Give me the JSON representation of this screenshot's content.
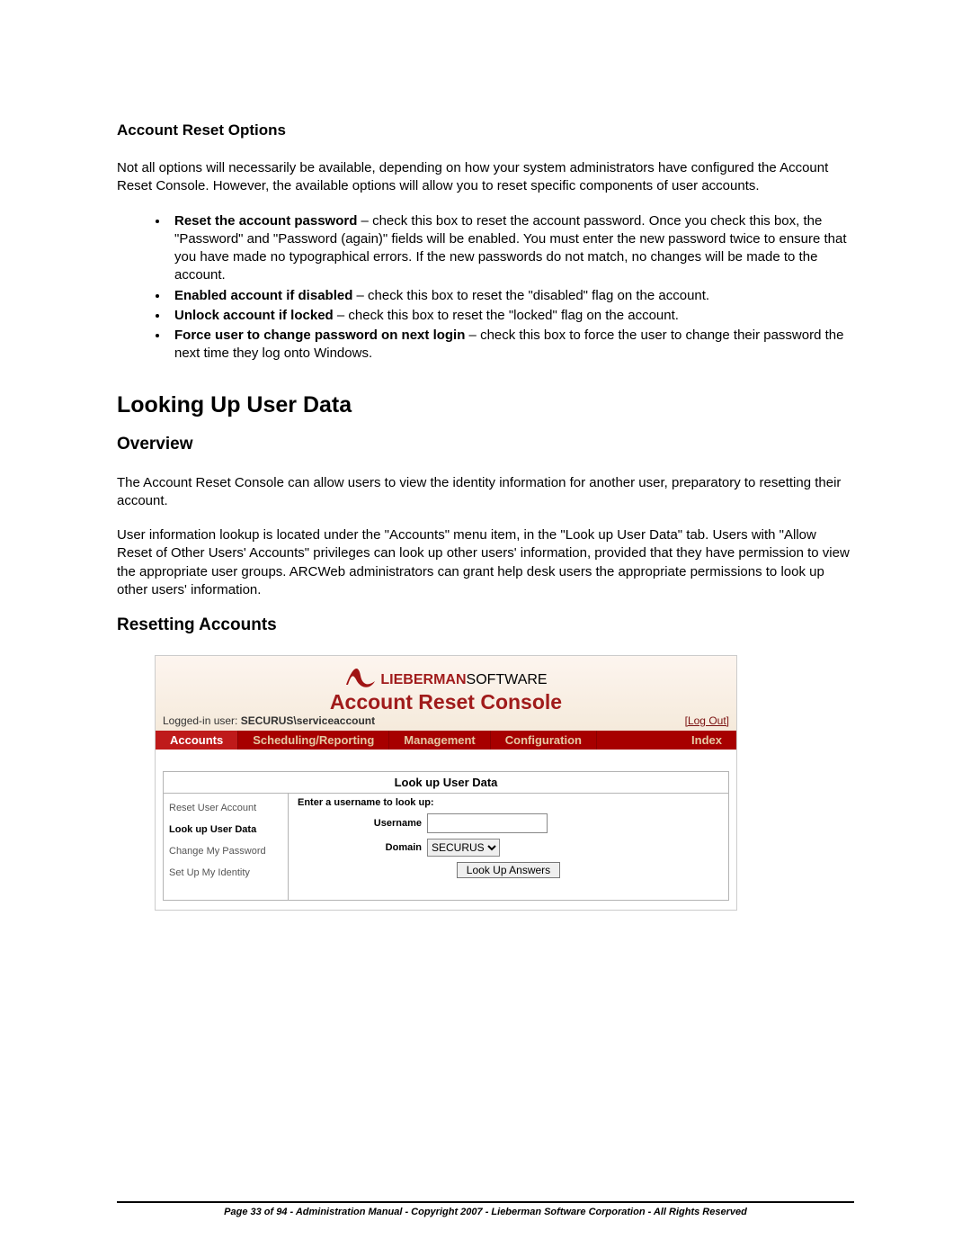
{
  "section1": {
    "title": "Account Reset Options",
    "intro": "Not all options will necessarily be available, depending on how your system administrators have configured the Account Reset Console.  However, the available options will allow you to reset specific components of user accounts.",
    "bullets": [
      {
        "strong": "Reset the account password",
        "rest": " – check this box to reset the account password.  Once you check this box, the \"Password\" and \"Password (again)\" fields will be enabled.  You must enter the new password twice to ensure that you have made no typographical errors.  If the new passwords do not match, no changes will be made to the account."
      },
      {
        "strong": "Enabled account if disabled",
        "rest": " – check this box to reset the \"disabled\" flag on the account."
      },
      {
        "strong": "Unlock account if locked",
        "rest": " – check this box to reset the \"locked\" flag on the account."
      },
      {
        "strong": "Force user to change password on next login",
        "rest": " – check this box to force the user to change their password the next time they log onto Windows."
      }
    ]
  },
  "section2": {
    "title": "Looking Up User Data",
    "sub1": "Overview",
    "p1": "The Account Reset Console can allow users to view the identity information for another user, preparatory to resetting their account.",
    "p2": "User information lookup is located under the \"Accounts\" menu item, in the \"Look up User Data\" tab.  Users with \"Allow Reset of Other Users' Accounts\" privileges can look up other users' information, provided that they have permission to view the appropriate user groups.  ARCWeb administrators can grant help desk users the appropriate permissions to look up other users' information.",
    "sub2": "Resetting Accounts"
  },
  "screenshot": {
    "brand_bold": "LIEBERMAN",
    "brand_thin": "SOFTWARE",
    "app_title": "Account Reset Console",
    "logged_in_prefix": "Logged-in user: ",
    "logged_in_user": "SECURUS\\serviceaccount",
    "logout": "[Log Out]",
    "nav": [
      {
        "label": "Accounts",
        "active": true
      },
      {
        "label": "Scheduling/Reporting",
        "active": false
      },
      {
        "label": "Management",
        "active": false
      },
      {
        "label": "Configuration",
        "active": false
      },
      {
        "label": "Index",
        "active": false
      }
    ],
    "panel_title": "Look up User Data",
    "sidenav": [
      {
        "label": "Reset User Account",
        "active": false
      },
      {
        "label": "Look up User Data",
        "active": true
      },
      {
        "label": "Change My Password",
        "active": false
      },
      {
        "label": "Set Up My Identity",
        "active": false
      }
    ],
    "form": {
      "prompt": "Enter a username to look up:",
      "username_label": "Username",
      "username_value": "",
      "domain_label": "Domain",
      "domain_value": "SECURUS",
      "button": "Look Up Answers"
    }
  },
  "footer": "Page 33 of 94 - Administration Manual - Copyright 2007 - Lieberman Software Corporation - All Rights Reserved"
}
